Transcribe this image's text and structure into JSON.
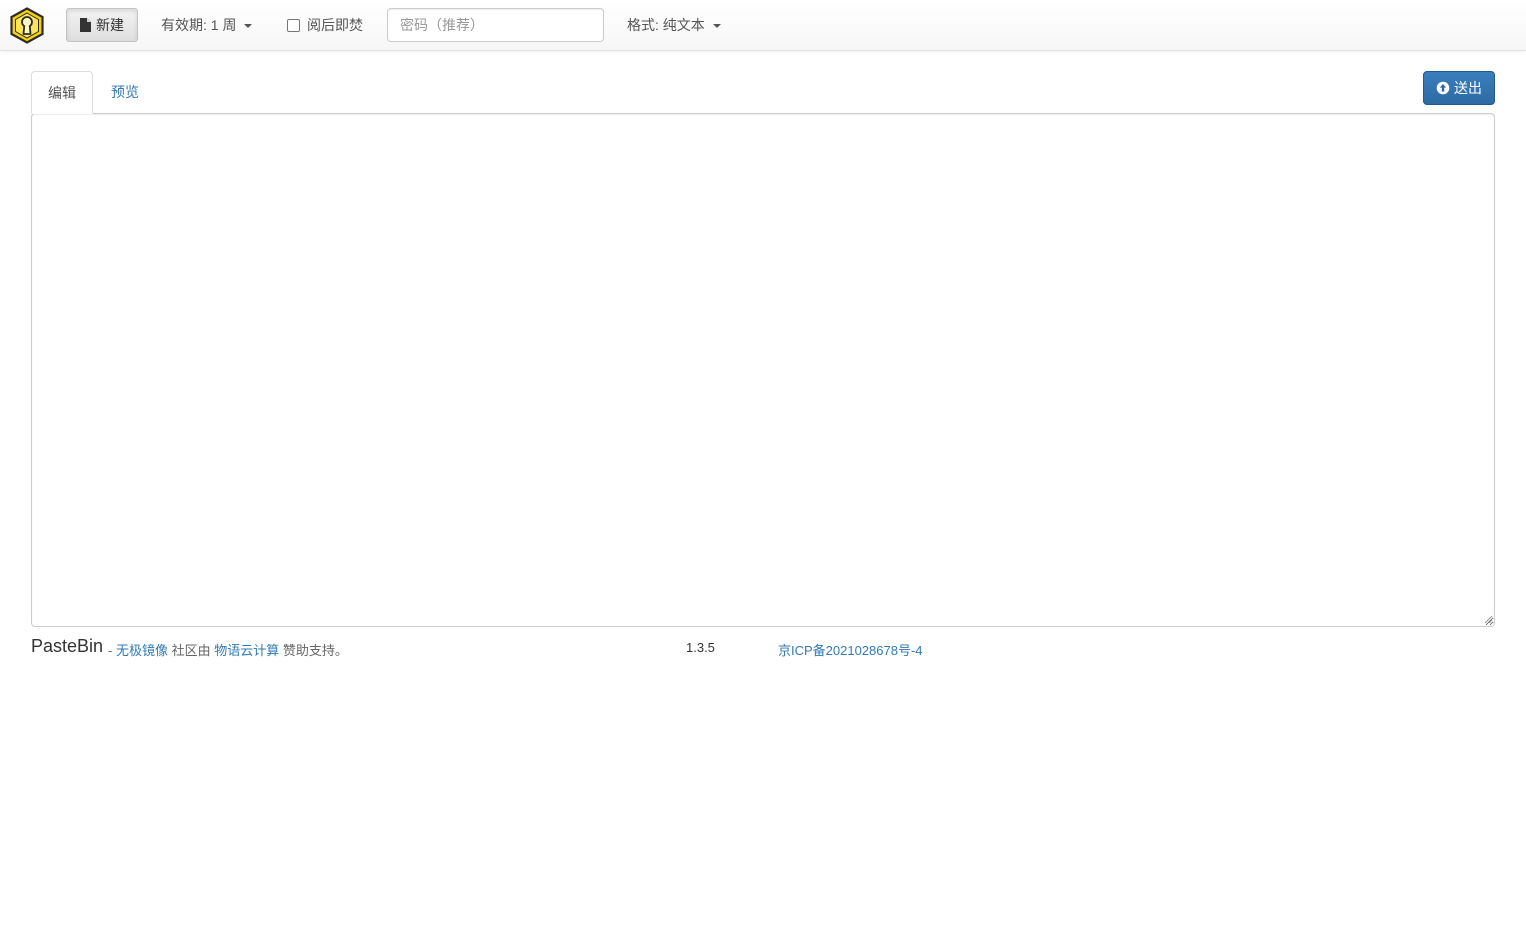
{
  "navbar": {
    "logo_icon": "keyhole-hexagon-icon",
    "new_button": {
      "label": "新建",
      "icon": "document-icon"
    },
    "expiration": {
      "label": "有效期: 1 周"
    },
    "burn_after_reading": {
      "label": "阅后即焚",
      "checked": false
    },
    "password": {
      "value": "",
      "placeholder": "密码（推荐）"
    },
    "format": {
      "label": "格式: 纯文本"
    }
  },
  "tabs": [
    {
      "label": "编辑",
      "active": true
    },
    {
      "label": "预览",
      "active": false
    }
  ],
  "send_button": {
    "label": "送出",
    "icon": "upload-circle-icon"
  },
  "editor": {
    "value": ""
  },
  "footer": {
    "brand": "PasteBin",
    "separator": " - ",
    "mirror_link": "无极镜像",
    "community_text": " 社区由 ",
    "sponsor_link": "物语云计算",
    "support_text": " 赞助支持。",
    "version": "1.3.5",
    "icp": "京ICP备2021028678号-4"
  },
  "colors": {
    "link": "#337ab7",
    "primary_button": "#2d6aa3",
    "logo_fill": "#f5d20a"
  }
}
